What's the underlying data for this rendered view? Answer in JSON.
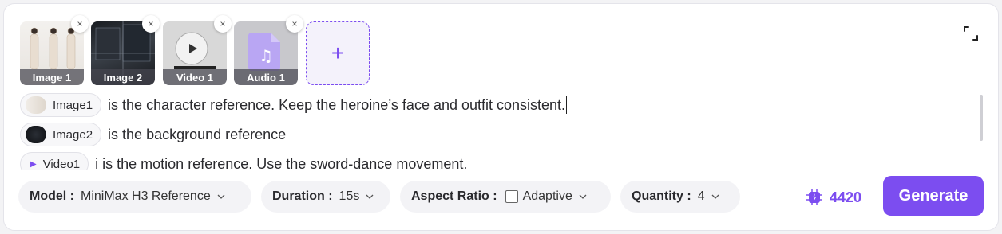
{
  "assets": [
    {
      "caption": "Image 1",
      "kind": "image"
    },
    {
      "caption": "Image 2",
      "kind": "image"
    },
    {
      "caption": "Video 1",
      "kind": "video"
    },
    {
      "caption": "Audio 1",
      "kind": "audio"
    }
  ],
  "close_glyph": "×",
  "add_glyph": "+",
  "prompt": {
    "lines": [
      {
        "chip": "Image1",
        "text": "is the character reference. Keep the heroine’s face and outfit consistent."
      },
      {
        "chip": "Image2",
        "text": "is the background reference"
      },
      {
        "chip": "Video1",
        "text": "i is the motion reference. Use the sword-dance movement."
      }
    ]
  },
  "toolbar": {
    "model_label": "Model :",
    "model_value": "MiniMax H3 Reference",
    "duration_label": "Duration :",
    "duration_value": "15s",
    "aspect_label": "Aspect Ratio :",
    "aspect_value": "Adaptive",
    "quantity_label": "Quantity :",
    "quantity_value": "4",
    "credits": "4420",
    "generate_label": "Generate"
  },
  "colors": {
    "accent": "#7c4df0",
    "panel": "#ffffff",
    "pill": "#f3f3f6"
  }
}
